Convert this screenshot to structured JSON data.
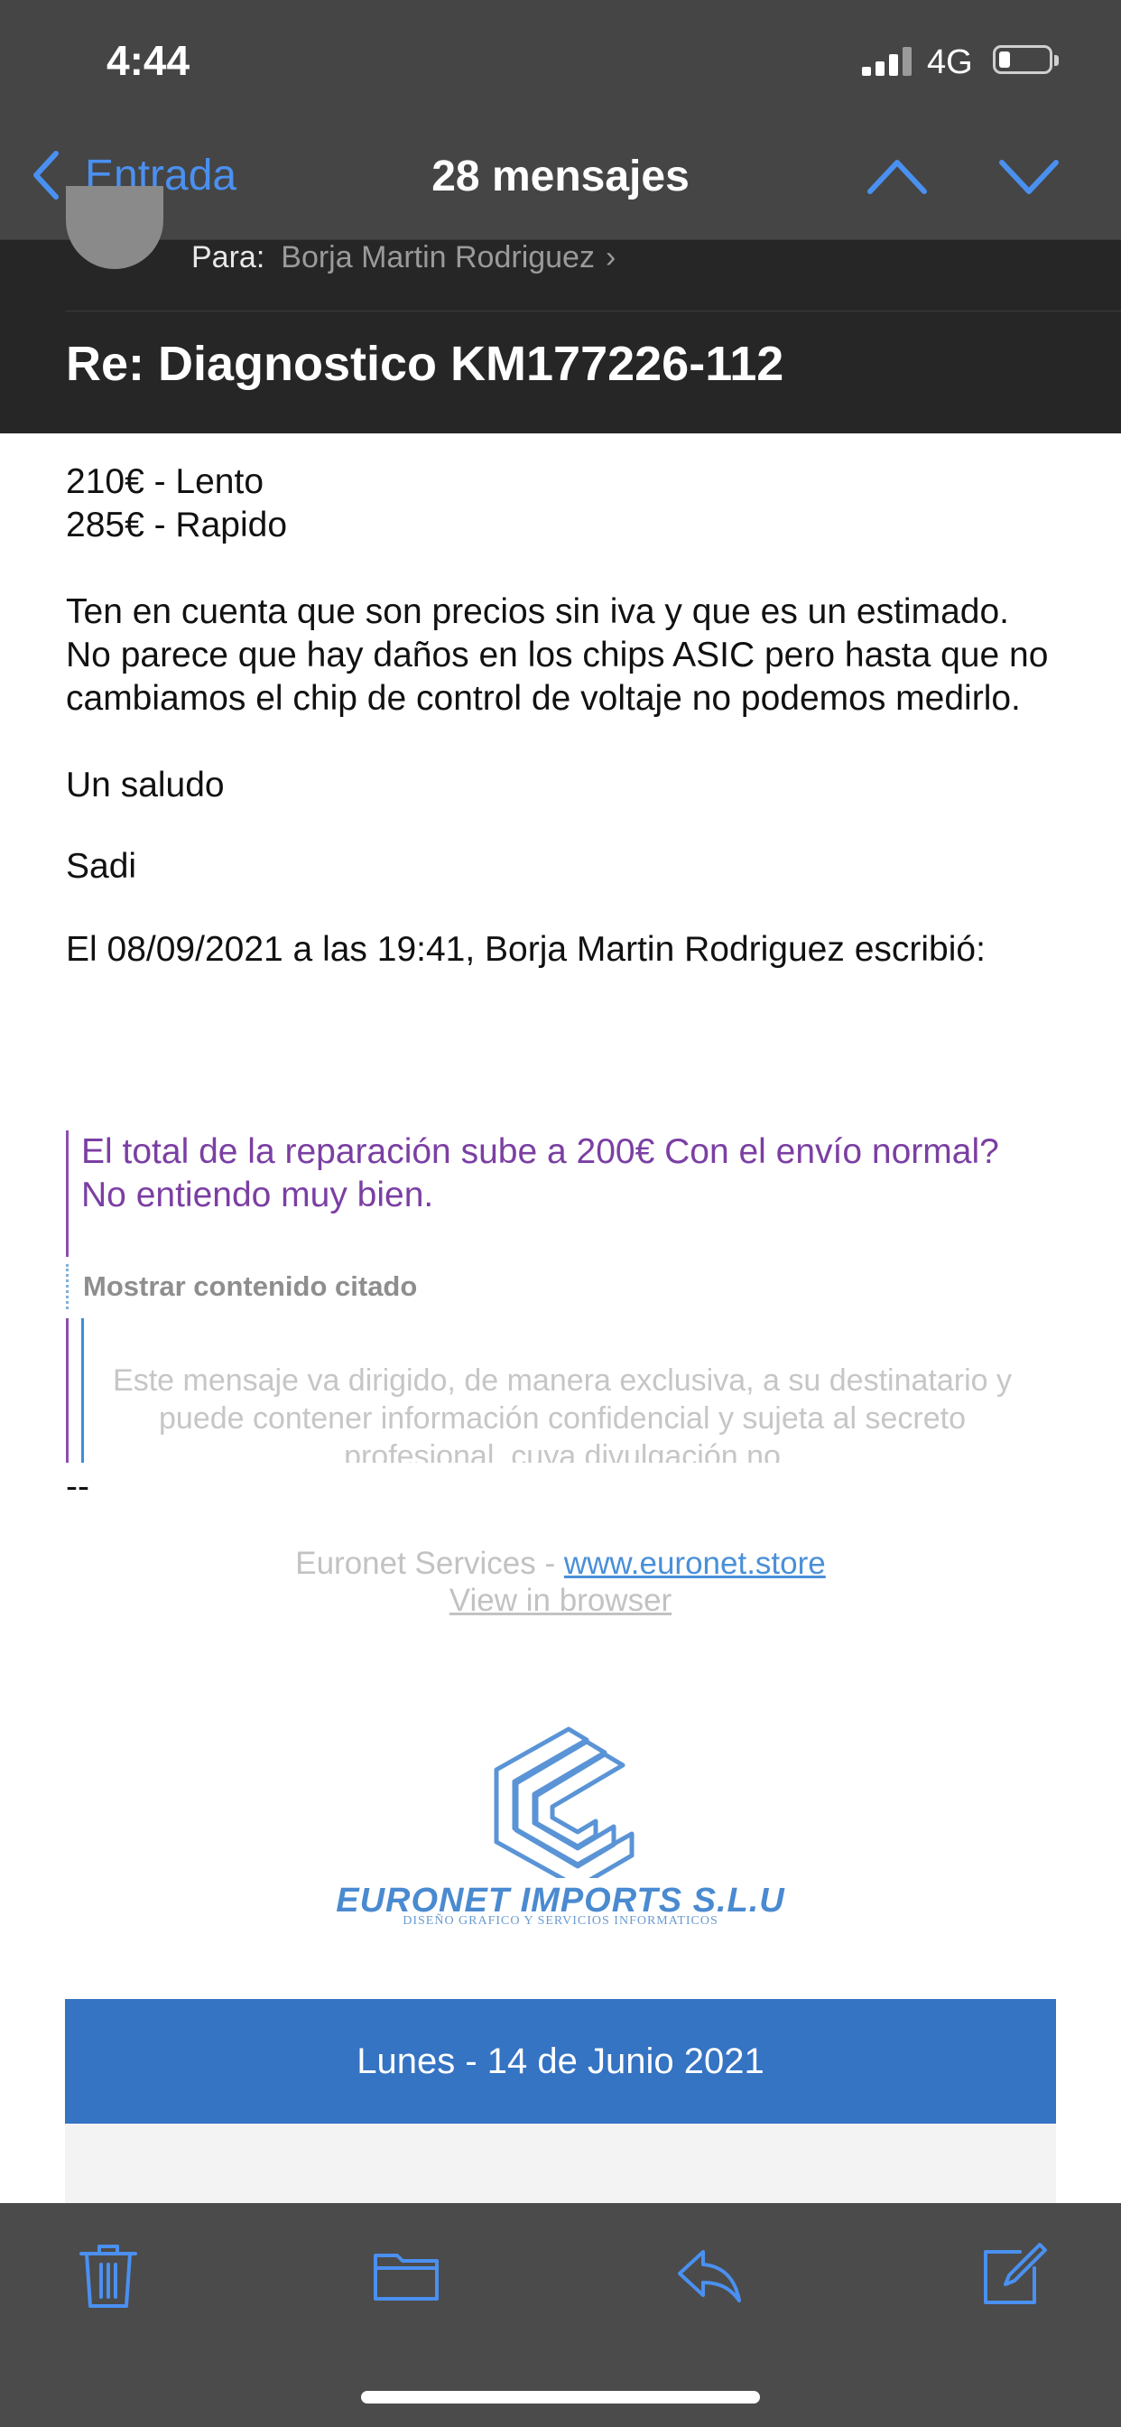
{
  "status_bar": {
    "time": "4:44",
    "network": "4G"
  },
  "nav": {
    "back_label": "Entrada",
    "title": "28 mensajes"
  },
  "header": {
    "to_label": "Para:",
    "to_name": "Borja Martin Rodriguez",
    "subject": "Re: Diagnostico KM177226-112"
  },
  "body": {
    "lines": [
      "210€ - Lento",
      "285€ - Rapido",
      "Ten en cuenta que son precios sin iva y que es un estimado.",
      "No parece que hay daños en los chips ASIC pero hasta que no cambiamos el chip de control de voltaje no podemos medirlo.",
      "Un saludo",
      "Sadi",
      "El 08/09/2021 a las 19:41, Borja Martin Rodriguez escribió:"
    ],
    "quote": "El total de la reparación sube a 200€ Con el envío normal? No entiendo muy bien.",
    "show_quoted": "Mostrar contenido citado",
    "disclaimer": "Este mensaje va dirigido, de manera exclusiva, a su destinatario y puede contener información confidencial y sujeta al secreto profesional, cuya divulgación no",
    "signature_dashes": "--"
  },
  "footer": {
    "company_prefix": "Euronet Services - ",
    "company_link": "www.euronet.store",
    "view_in_browser": "View in browser",
    "logo_name": "EURONET IMPORTS S.L.U",
    "logo_tagline": "DISEÑO GRAFICO Y SERVICIOS INFORMATICOS",
    "date_banner": "Lunes - 14 de Junio 2021"
  },
  "toolbar": {
    "icons": [
      "trash-icon",
      "folder-icon",
      "reply-icon",
      "compose-icon"
    ]
  },
  "colors": {
    "accent": "#4a90f0",
    "quote_purple": "#7b3fa3",
    "banner_blue": "#3573c3",
    "dark_header": "#262626"
  }
}
